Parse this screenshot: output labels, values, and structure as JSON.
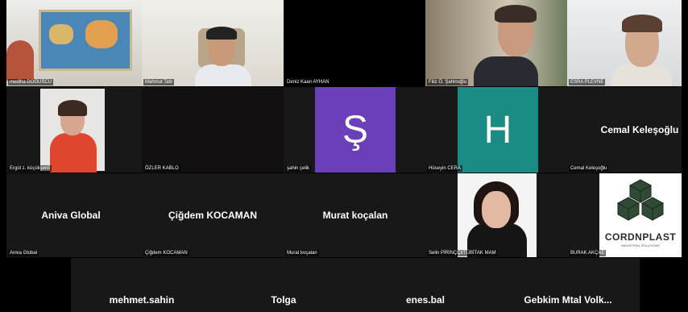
{
  "row1": [
    {
      "caption": "mediha DOĞUSCU"
    },
    {
      "caption": "Mahmut Tatlı"
    },
    {
      "caption": "Deniz Kaan AYHAN"
    },
    {
      "caption": "Filiz Ö. Şahinoğlu"
    },
    {
      "caption": "ESRA PLEVNE"
    }
  ],
  "row2": [
    {
      "caption": "Ergül z. küçükşenli"
    },
    {
      "caption": "ÖZLER KABLO"
    },
    {
      "caption": "şahin çelik",
      "avatar_letter": "Ş",
      "avatar_color": "#6a3fb8"
    },
    {
      "caption": "Hüseyin CERA",
      "avatar_letter": "H",
      "avatar_color": "#1a8c84"
    },
    {
      "caption": "Cemal Keleşoğlu",
      "display_name": "Cemal Keleşoğlu"
    }
  ],
  "row3": [
    {
      "caption": "Aniva Global",
      "display_name": "Aniva Global"
    },
    {
      "caption": "Çiğdem KOCAMAN",
      "display_name": "Çiğdem KOCAMAN"
    },
    {
      "caption": "Murat koçalan",
      "display_name": "Murat koçalan"
    },
    {
      "caption": "Selin PİRİNÇÇİ/TÜBİTAK MAM"
    },
    {
      "caption": "BURAK AKÇAE",
      "logo_text": "CORDNPLAST",
      "logo_sub": "INDUSTRIAL SOLUTIONS"
    }
  ],
  "row4": [
    {
      "display_name": "mehmet.sahin"
    },
    {
      "display_name": "Tolga"
    },
    {
      "display_name": "enes.bal"
    },
    {
      "display_name": "Gebkim  Mtal  Volk..."
    }
  ]
}
